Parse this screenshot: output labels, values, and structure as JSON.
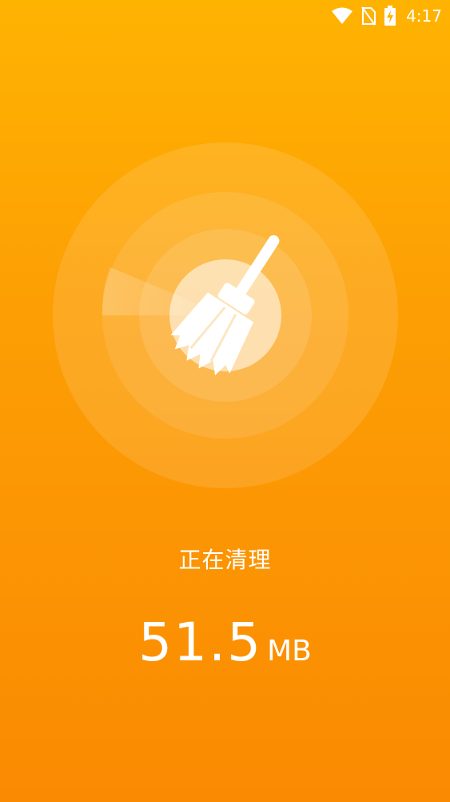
{
  "status_bar": {
    "time": "4:17",
    "icons": [
      "wifi-icon",
      "no-sim-icon",
      "battery-charging-icon"
    ]
  },
  "cleaning": {
    "status_text": "正在清理",
    "size_value": "51.5",
    "size_unit": "MB",
    "icon": "broom-icon"
  },
  "colors": {
    "gradient_top": "#FFB301",
    "gradient_bottom": "#FA8A02",
    "foreground": "#FFFFFF"
  }
}
